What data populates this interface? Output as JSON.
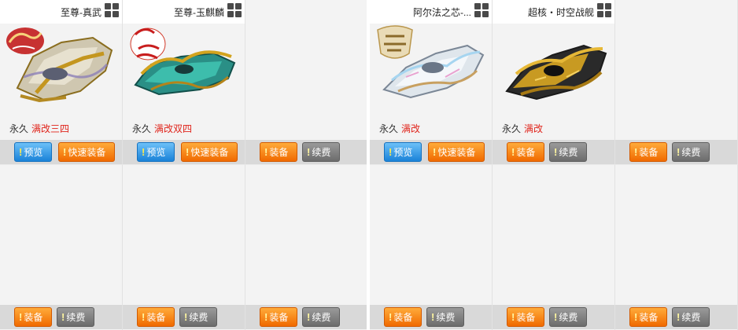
{
  "cells": [
    {
      "title": "至尊-真武",
      "has_car": true,
      "car_theme": "gold-silver",
      "badge": "snake-year-limited",
      "duration": "永久",
      "mod": "满改三四",
      "btn1": "预览",
      "btn2": "快速装备"
    },
    {
      "title": "至尊-玉麒麟",
      "has_car": true,
      "car_theme": "teal-gold",
      "badge": "rabbit-year-limited",
      "duration": "永久",
      "mod": "满改双四",
      "btn1": "预览",
      "btn2": "快速装备"
    },
    {
      "title": "",
      "has_car": false,
      "btn1": "装备",
      "btn2": "续费"
    },
    {
      "title": "阿尔法之芯-...",
      "has_car": true,
      "car_theme": "silver-prism",
      "badge": "zhushen-zhizhan",
      "duration": "永久",
      "mod": "满改",
      "btn1": "预览",
      "btn2": "快速装备"
    },
    {
      "title": "超核・时空战舰",
      "has_car": true,
      "car_theme": "black-gold",
      "badge": "",
      "duration": "永久",
      "mod": "满改",
      "btn1": "装备",
      "btn2": "续费"
    },
    {
      "title": "",
      "has_car": false,
      "btn1": "装备",
      "btn2": "续费"
    },
    {
      "title": "",
      "has_car": false,
      "btn1": "装备",
      "btn2": "续费"
    },
    {
      "title": "",
      "has_car": false,
      "btn1": "装备",
      "btn2": "续费"
    },
    {
      "title": "",
      "has_car": false,
      "btn1": "装备",
      "btn2": "续费"
    },
    {
      "title": "",
      "has_car": false,
      "btn1": "装备",
      "btn2": "续费"
    },
    {
      "title": "",
      "has_car": false,
      "btn1": "装备",
      "btn2": "续费"
    },
    {
      "title": "",
      "has_car": false,
      "btn1": "装备",
      "btn2": "续费"
    }
  ],
  "colors": {
    "accent_red": "#e0241b",
    "btn_blue": "#1a82d8",
    "btn_orange": "#f06a00",
    "btn_gray": "#6c6c6c"
  },
  "icons": {
    "grid_menu": "grid-menu-icon",
    "bang": "exclamation"
  }
}
